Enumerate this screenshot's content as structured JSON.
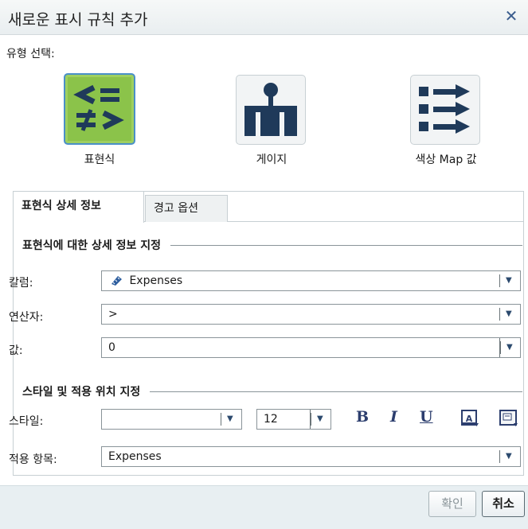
{
  "dialog": {
    "title": "새로운 표시 규칙 추가"
  },
  "type_select": {
    "label": "유형 선택:",
    "options": [
      {
        "label": "표현식",
        "icon": "expression-icon",
        "selected": true
      },
      {
        "label": "게이지",
        "icon": "gauge-icon",
        "selected": false
      },
      {
        "label": "색상 Map 값",
        "icon": "color-map-icon",
        "selected": false
      }
    ]
  },
  "tabs": [
    {
      "label": "표현식 상세 정보",
      "active": true
    },
    {
      "label": "경고 옵션",
      "active": false
    }
  ],
  "expression": {
    "section_title": "표현식에 대한 상세 정보 지정",
    "column": {
      "label": "칼럼:",
      "value": "Expenses",
      "icon": "measure-icon"
    },
    "operator": {
      "label": "연산자:",
      "value": ">"
    },
    "value": {
      "label": "값:",
      "value": "0"
    }
  },
  "style": {
    "section_title": "스타일 및 적용 위치 지정",
    "style_label": "스타일:",
    "style_value": "",
    "font_size": "12",
    "bold": "B",
    "italic": "I",
    "underline": "U",
    "apply_label": "적용 항목:",
    "apply_value": "Expenses"
  },
  "buttons": {
    "ok": "확인",
    "cancel": "취소"
  },
  "colors": {
    "accent": "#2c4a6e",
    "selected_tile": "#8bc34a",
    "selected_border": "#4a90c8"
  }
}
